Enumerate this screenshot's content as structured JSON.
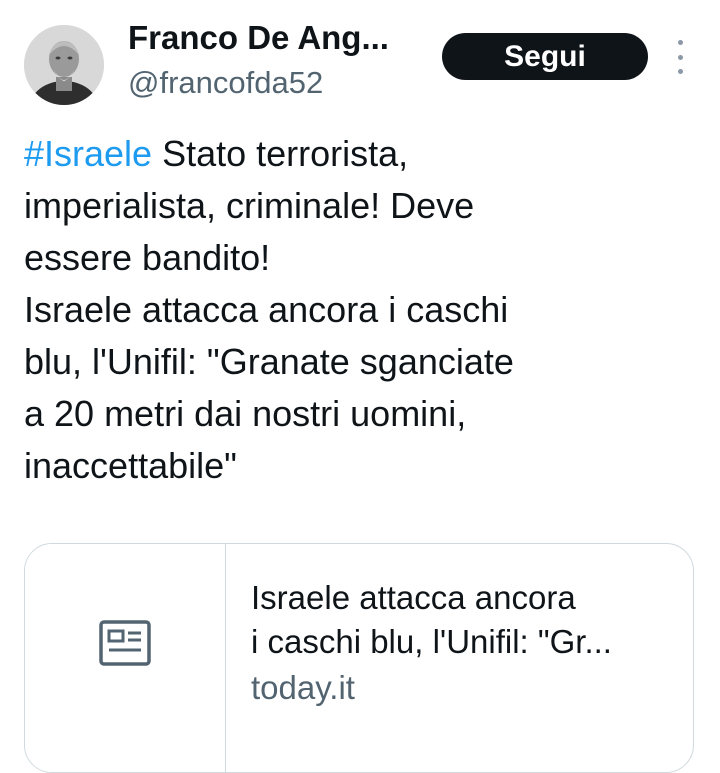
{
  "author": {
    "display_name": "Franco De Ang...",
    "handle": "@francofda52"
  },
  "actions": {
    "follow_label": "Segui"
  },
  "tweet": {
    "hashtag": "#Israele",
    "lines": [
      " Stato terrorista,",
      "imperialista, criminale! Deve",
      "essere bandito!",
      "Israele attacca ancora i caschi",
      "blu, l'Unifil: \"Granate sganciate",
      "a 20 metri dai nostri uomini,",
      "inaccettabile\""
    ]
  },
  "link_card": {
    "icon": "news-article-icon",
    "title_lines": [
      "Israele attacca ancora",
      "i caschi blu, l'Unifil: \"Gr..."
    ],
    "domain": "today.it"
  },
  "colors": {
    "hashtag": "#1d9bf0",
    "button_bg": "#0f1419",
    "secondary_text": "#536471",
    "border": "#cfd9de"
  }
}
